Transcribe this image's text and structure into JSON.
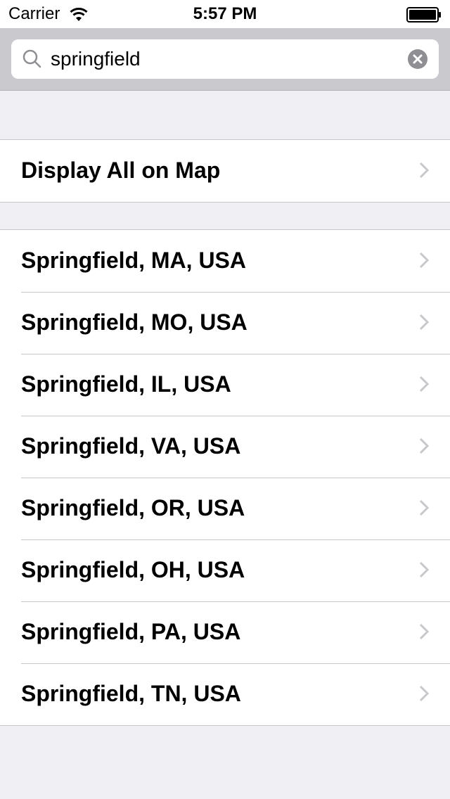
{
  "status_bar": {
    "carrier": "Carrier",
    "time": "5:57 PM",
    "wifi_icon": "wifi-icon",
    "battery_icon": "battery-icon"
  },
  "search": {
    "value": "springfield",
    "search_icon": "search-icon",
    "clear_icon": "clear-icon"
  },
  "display_all": {
    "label": "Display All on Map"
  },
  "results": [
    "Springfield, MA, USA",
    "Springfield, MO, USA",
    "Springfield, IL, USA",
    "Springfield, VA, USA",
    "Springfield, OR, USA",
    "Springfield, OH, USA",
    "Springfield, PA, USA",
    "Springfield, TN, USA"
  ],
  "colors": {
    "background": "#efeff4",
    "search_bar": "#c9c9ce",
    "separator": "#c8c7cc",
    "chevron": "#c7c7cc"
  }
}
